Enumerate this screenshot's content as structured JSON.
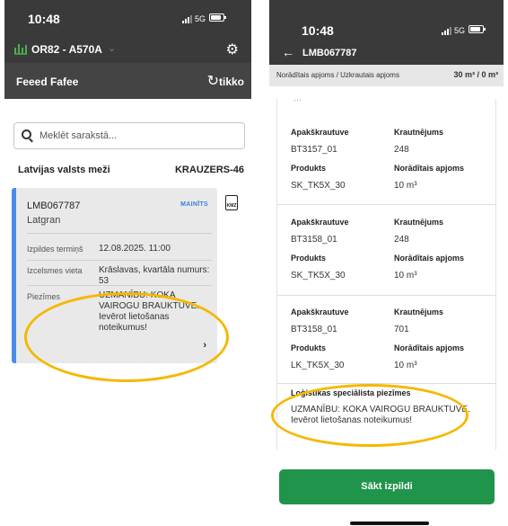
{
  "left": {
    "status": {
      "time": "10:48",
      "network": "5G"
    },
    "appbar": {
      "title": "OR82 - A570A"
    },
    "subbar": {
      "company": "Feeed Fafee",
      "user": "tikko"
    },
    "search": {
      "placeholder": "Meklēt sarakstā..."
    },
    "section": {
      "org": "Latvijas valsts meži",
      "code": "KRAUZERS-46"
    },
    "card": {
      "id": "LMB067787",
      "company": "Latgran",
      "badge": "MAINĪTS",
      "deadline_label": "Izpildes termiņš",
      "deadline_value": "12.08.2025. 11:00",
      "origin_label": "Izcelsmes vieta",
      "origin_value": "Krāslavas, kvartāla numurs: 53",
      "notes_label": "Piezīmes",
      "notes_value": "UZMANĪBU: KOKA VAIROGU BRAUKTUVE. Ievērot lietošanas noteikumus!"
    },
    "kmz": "KMZ"
  },
  "right": {
    "status": {
      "time": "10:48",
      "network": "5G"
    },
    "appbar": {
      "title": "LMB067787"
    },
    "infobar": {
      "label": "Norādītais apjoms / Uzkrautais apjoms",
      "value": "30 m³ / 0 m³"
    },
    "rows": [
      {
        "sub_label": "Apakškrautuve",
        "sub_value": "BT3157_01",
        "load_label": "Krautnējums",
        "load_value": "248",
        "prod_label": "Produkts",
        "prod_value": "SK_TK5X_30",
        "vol_label": "Norādītais apjoms",
        "vol_value": "10 m³"
      },
      {
        "sub_label": "Apakškrautuve",
        "sub_value": "BT3158_01",
        "load_label": "Krautnējums",
        "load_value": "248",
        "prod_label": "Produkts",
        "prod_value": "SK_TK5X_30",
        "vol_label": "Norādītais apjoms",
        "vol_value": "10 m³"
      },
      {
        "sub_label": "Apakškrautuve",
        "sub_value": "BT3158_01",
        "load_label": "Krautnējums",
        "load_value": "701",
        "prod_label": "Produkts",
        "prod_value": "LK_TK5X_30",
        "vol_label": "Norādītais apjoms",
        "vol_value": "10 m³"
      }
    ],
    "notes": {
      "title": "Loģistikas speciālista piezīmes",
      "text": "UZMANĪBU: KOKA VAIROGU BRAUKTUVE. Ievērot lietošanas noteikumus!"
    },
    "start_button": "Sākt izpildi"
  },
  "highlight_color": "#f5b800",
  "accent_color": "#21944c"
}
